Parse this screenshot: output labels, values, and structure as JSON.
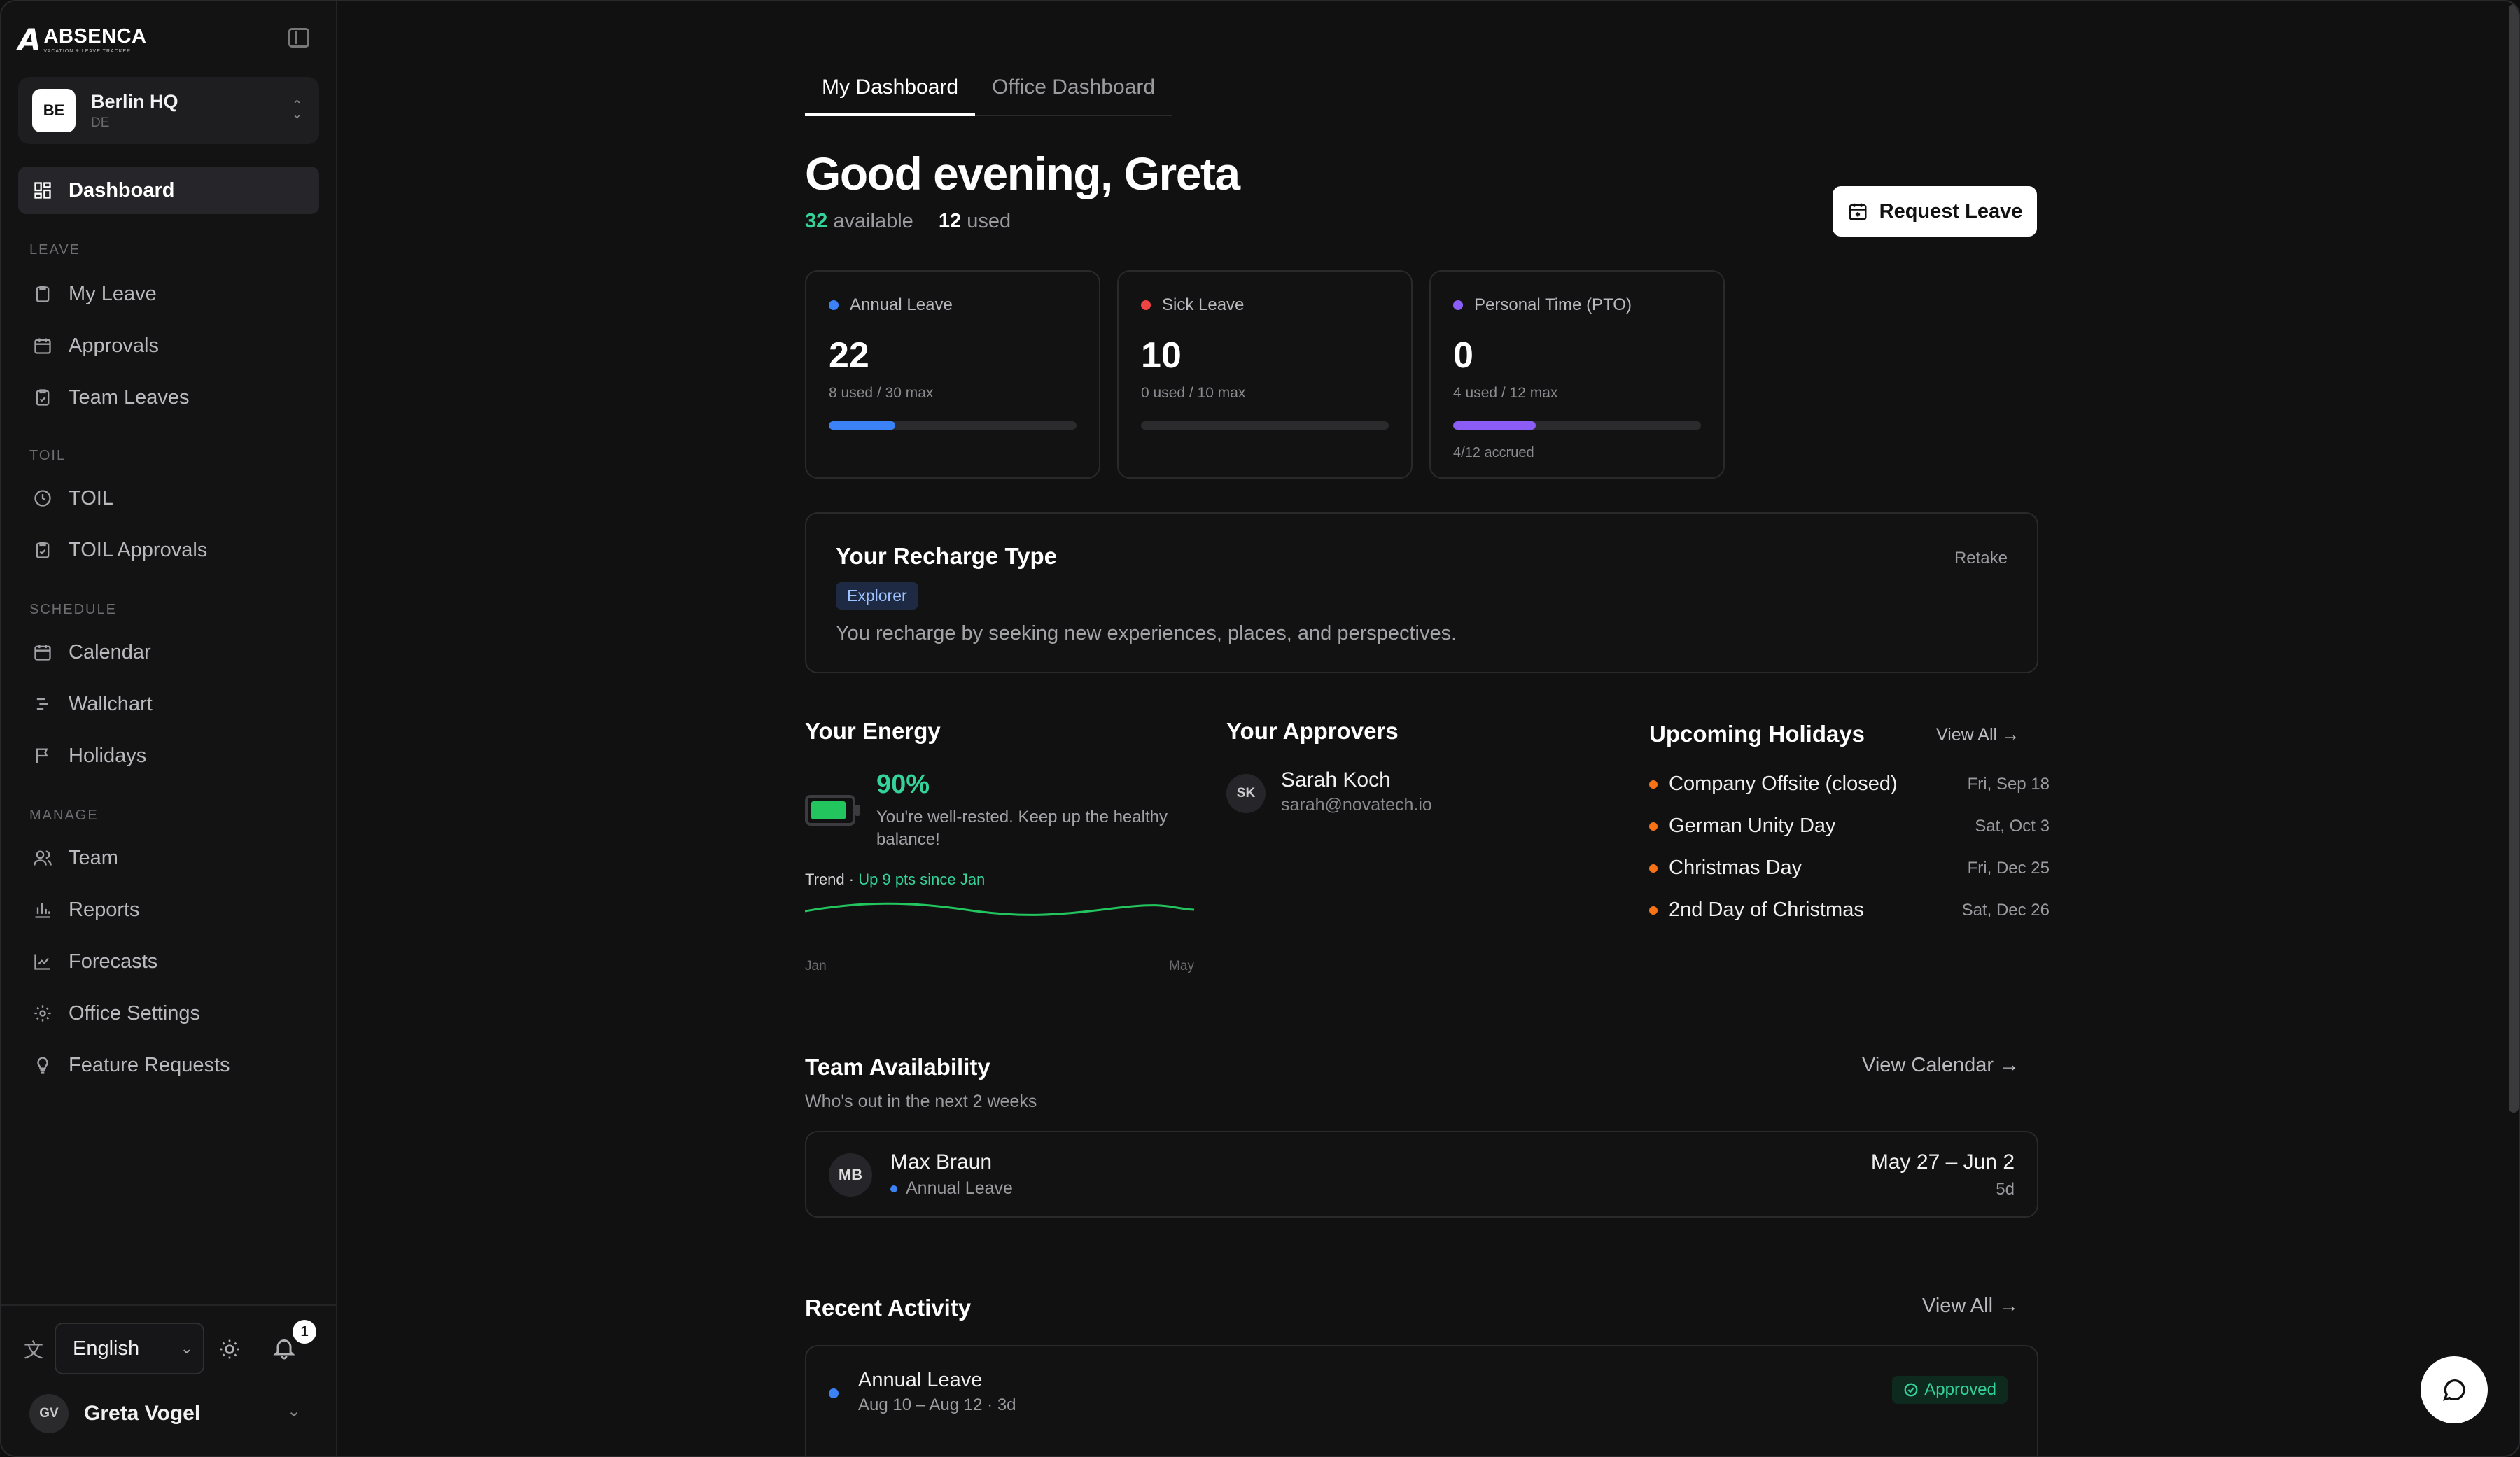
{
  "brand": {
    "name": "ABSENCA",
    "tagline": "VACATION & LEAVE TRACKER",
    "mark": "A"
  },
  "office": {
    "badge": "BE",
    "name": "Berlin HQ",
    "code": "DE"
  },
  "nav": {
    "dashboard": "Dashboard",
    "section_leave": "LEAVE",
    "my_leave": "My Leave",
    "approvals": "Approvals",
    "team_leaves": "Team Leaves",
    "section_toil": "TOIL",
    "toil": "TOIL",
    "toil_approvals": "TOIL Approvals",
    "section_schedule": "SCHEDULE",
    "calendar": "Calendar",
    "wallchart": "Wallchart",
    "holidays": "Holidays",
    "section_manage": "MANAGE",
    "team": "Team",
    "reports": "Reports",
    "forecasts": "Forecasts",
    "office_settings": "Office Settings",
    "feature_requests": "Feature Requests"
  },
  "footer": {
    "language": "English",
    "notifications_count": "1",
    "user_initials": "GV",
    "user_name": "Greta Vogel"
  },
  "tabs": {
    "my": "My Dashboard",
    "office": "Office Dashboard"
  },
  "greeting": "Good evening, Greta",
  "summary": {
    "available": "32",
    "available_label": "available",
    "used": "12",
    "used_label": "used"
  },
  "request_leave": "Request Leave",
  "balances": [
    {
      "label": "Annual Leave",
      "value": "22",
      "sub": "8 used / 30 max",
      "color": "#3b82f6",
      "fill_fraction": 0.267
    },
    {
      "label": "Sick Leave",
      "value": "10",
      "sub": "0 used / 10 max",
      "color": "#ef4444",
      "fill_fraction": 0
    },
    {
      "label": "Personal Time (PTO)",
      "value": "0",
      "sub": "4 used / 12 max",
      "color": "#8b5cf6",
      "fill_fraction": 0.333,
      "accrued": "4/12 accrued"
    }
  ],
  "recharge": {
    "title": "Your Recharge Type",
    "type": "Explorer",
    "description": "You recharge by seeking new experiences, places, and perspectives.",
    "retake": "Retake"
  },
  "energy": {
    "title": "Your Energy",
    "percent": "90%",
    "level_fraction": 0.9,
    "message": "You're well-rested. Keep up the healthy balance!",
    "trend_label": "Trend",
    "trend_sep": "·",
    "trend_value": "Up 9 pts since Jan",
    "axis_start": "Jan",
    "axis_end": "May"
  },
  "approvers": {
    "title": "Your Approvers",
    "items": [
      {
        "initials": "SK",
        "name": "Sarah Koch",
        "email": "sarah@novatech.io"
      }
    ]
  },
  "holidays": {
    "title": "Upcoming Holidays",
    "view_all": "View All",
    "items": [
      {
        "name": "Company Offsite (closed)",
        "date": "Fri, Sep 18"
      },
      {
        "name": "German Unity Day",
        "date": "Sat, Oct 3"
      },
      {
        "name": "Christmas Day",
        "date": "Fri, Dec 25"
      },
      {
        "name": "2nd Day of Christmas",
        "date": "Sat, Dec 26"
      }
    ]
  },
  "availability": {
    "title": "Team Availability",
    "subtitle": "Who's out in the next 2 weeks",
    "view_calendar": "View Calendar",
    "items": [
      {
        "initials": "MB",
        "name": "Max Braun",
        "type": "Annual Leave",
        "range": "May 27 – Jun 2",
        "days": "5d"
      }
    ]
  },
  "activity": {
    "title": "Recent Activity",
    "view_all": "View All",
    "items": [
      {
        "title": "Annual Leave",
        "sub": "Aug 10 – Aug 12 · 3d",
        "status": "Approved"
      }
    ]
  }
}
